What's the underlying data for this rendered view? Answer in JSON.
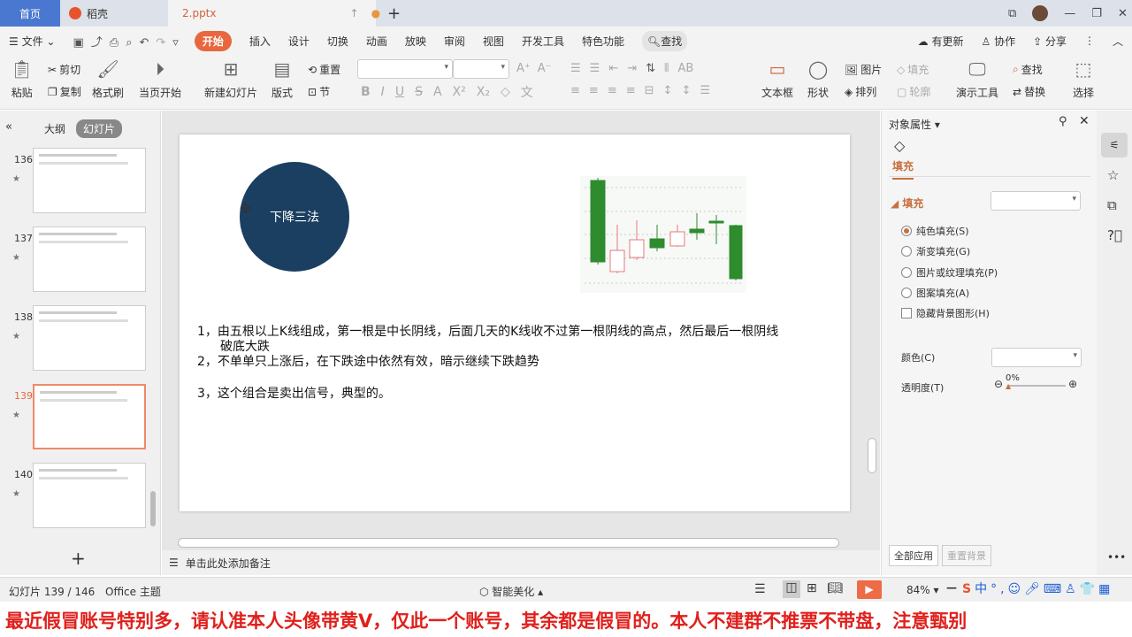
{
  "tabs": [
    {
      "label": "首页"
    },
    {
      "label": "稻壳"
    },
    {
      "label": "2.pptx"
    }
  ],
  "menu": {
    "file": "文件",
    "items": [
      "开始",
      "插入",
      "设计",
      "切换",
      "动画",
      "放映",
      "审阅",
      "视图",
      "开发工具",
      "特色功能"
    ],
    "search": "查找",
    "update": "有更新",
    "collab": "协作",
    "share": "分享"
  },
  "ribbon": {
    "paste": "粘贴",
    "cut": "剪切",
    "copy": "复制",
    "format_painter": "格式刷",
    "play_current": "当页开始",
    "new_slide": "新建幻灯片",
    "layout": "版式",
    "reset": "重置",
    "section": "节",
    "textbox": "文本框",
    "shape": "形状",
    "picture": "图片",
    "fill": "填充",
    "arrange": "排列",
    "outline": "轮廓",
    "present_tools": "演示工具",
    "find": "查找",
    "replace": "替换",
    "select": "选择"
  },
  "leftpane": {
    "outline_tab": "大纲",
    "slides_tab": "幻灯片",
    "slides": [
      {
        "num": "136"
      },
      {
        "num": "137"
      },
      {
        "num": "138"
      },
      {
        "num": "139",
        "active": true
      },
      {
        "num": "140"
      }
    ],
    "add": "+"
  },
  "slide": {
    "circle_label": "下降三法",
    "circle_color": "#1b3f61",
    "line1": "1，由五根以上K线组成，第一根是中长阴线，后面几天的K线收不过第一根阴线的高点，然后最后一根阴线",
    "line1b": "破底大跌",
    "line2": "2，不单单只上涨后，在下跌途中依然有效，暗示继续下跌趋势",
    "line3": "3，这个组合是卖出信号，典型的。"
  },
  "notes": {
    "placeholder": "单击此处添加备注"
  },
  "panel": {
    "title": "对象属性",
    "tab": "填充",
    "section": "填充",
    "options": [
      "纯色填充(S)",
      "渐变填充(G)",
      "图片或纹理填充(P)",
      "图案填充(A)"
    ],
    "selected": 0,
    "hide_bg": "隐藏背景图形(H)",
    "color_label": "颜色(C)",
    "transparency_label": "透明度(T)",
    "transparency": "0%",
    "apply_all": "全部应用",
    "reset_bg": "重置背景",
    "accent": "#c8703f"
  },
  "status": {
    "slide_info": "幻灯片 139 / 146",
    "theme": "Office 主题",
    "beautify": "智能美化",
    "zoom": "84%"
  },
  "banner": "最近假冒账号特别多，请认准本人头像带黄V，仅此一个账号，其余都是假冒的。本人不建群不推票不带盘，注意甄别"
}
